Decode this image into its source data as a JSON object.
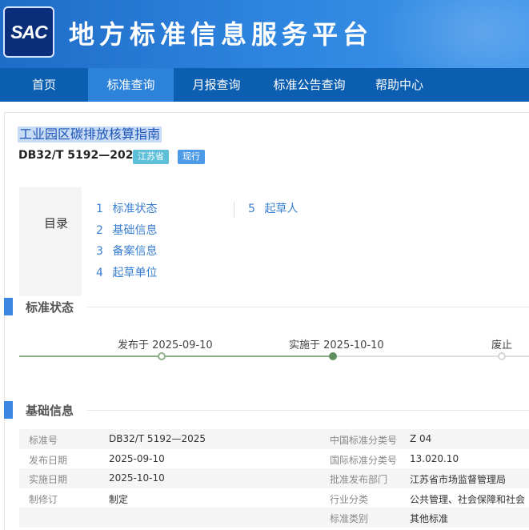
{
  "header": {
    "logo_text": "SAC",
    "site_title": "地方标准信息服务平台"
  },
  "nav": {
    "items": [
      {
        "label": "首页"
      },
      {
        "label": "标准查询"
      },
      {
        "label": "月报查询"
      },
      {
        "label": "标准公告查询"
      },
      {
        "label": "帮助中心"
      }
    ],
    "active_index": 1
  },
  "standard": {
    "title": "工业园区碳排放核算指南",
    "code": "DB32/T 5192—2025",
    "province_tag": "江苏省",
    "status_tag": "现行"
  },
  "toc": {
    "label": "目录",
    "items": [
      {
        "num": "1",
        "label": "标准状态"
      },
      {
        "num": "2",
        "label": "基础信息"
      },
      {
        "num": "3",
        "label": "备案信息"
      },
      {
        "num": "4",
        "label": "起草单位"
      },
      {
        "num": "5",
        "label": "起草人"
      }
    ]
  },
  "status_section": {
    "heading": "标准状态",
    "published": "发布于 2025-09-10",
    "implemented": "实施于 2025-10-10",
    "abolished": "废止"
  },
  "basic_section": {
    "heading": "基础信息",
    "rows": [
      {
        "k1": "标准号",
        "v1": "DB32/T 5192—2025",
        "k2": "中国标准分类号",
        "v2": "Z 04"
      },
      {
        "k1": "发布日期",
        "v1": "2025-09-10",
        "k2": "国际标准分类号",
        "v2": "13.020.10"
      },
      {
        "k1": "实施日期",
        "v1": "2025-10-10",
        "k2": "批准发布部门",
        "v2": "江苏省市场监督管理局"
      },
      {
        "k1": "制修订",
        "v1": "制定",
        "k2": "行业分类",
        "v2": "公共管理、社会保障和社会"
      },
      {
        "k1": "",
        "v1": "",
        "k2": "标准类别",
        "v2": "其他标准"
      }
    ]
  }
}
